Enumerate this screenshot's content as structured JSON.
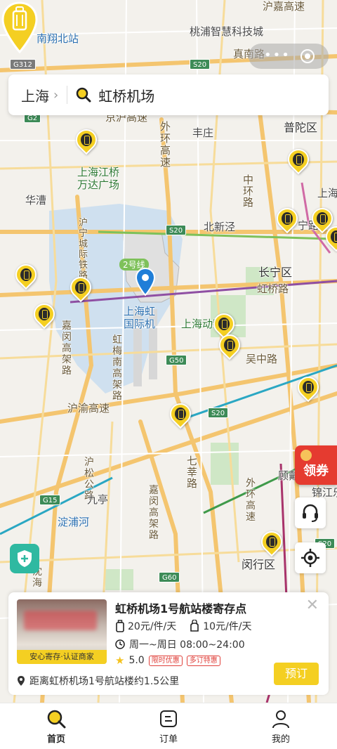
{
  "map": {
    "labels": {
      "nanxiang": "南翔北站",
      "taopu": "桃浦智慧科技城",
      "hujia": "沪嘉高速",
      "zhennan": "真南路",
      "fengzhuang": "丰庄",
      "putuo": "普陀区",
      "jinghu": "京沪高速",
      "wanda": "上海江桥\n万达广场",
      "waihuan1": "外环\n高速",
      "huacao": "华漕",
      "zhonghuan": "中环路",
      "beixinjing": "北新泾",
      "changning": "长宁区",
      "hongqiao_rd": "虹桥路",
      "hongqiao_airport": "上海虹\n国际机",
      "shanghai_zoo": "上海动物园",
      "wuzhong": "吴中路",
      "huning": "沪宁城际铁路",
      "jiamin": "嘉闵高架路",
      "hongmei": "虹梅南高架路",
      "huyu": "沪渝高速",
      "qishen": "七莘路",
      "husongt": "沪松公路",
      "jiuting": "九亭",
      "dianpu": "淀浦河",
      "waihuan2": "外环高速",
      "minhang": "闵行区",
      "gudai": "顾戴",
      "jinjiang": "锦江乐",
      "jiamin2": "嘉闵高架路",
      "line2": "2号线",
      "shanghai_right": "上海",
      "ning": "宁路",
      "shen": "沈海"
    },
    "shields": [
      "G312",
      "S20",
      "G2",
      "S20",
      "G50",
      "S20",
      "G15",
      "G60",
      "S20"
    ]
  },
  "search": {
    "city": "上海",
    "query": "虹桥机场"
  },
  "coupon_label": "领券",
  "card": {
    "title": "虹桥机场1号航站楼寄存点",
    "badge": "安心寄存·认证商家",
    "price_large": "20元/件/天",
    "price_small": "10元/件/天",
    "hours": "周一~周日 08:00~24:00",
    "rating": "5.0",
    "tag1": "限时优惠",
    "tag2": "多订特惠",
    "distance": "距离虹桥机场1号航站楼约1.5公里",
    "book_label": "预订"
  },
  "tabs": [
    {
      "label": "首页",
      "icon": "search-icon"
    },
    {
      "label": "订单",
      "icon": "order-icon"
    },
    {
      "label": "我的",
      "icon": "profile-icon"
    }
  ],
  "colors": {
    "accent": "#f4cf22",
    "coupon": "#e53b30",
    "shield": "#2fb9a1"
  }
}
